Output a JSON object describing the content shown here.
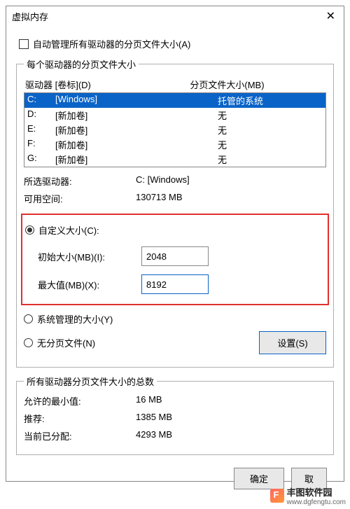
{
  "title": "虚拟内存",
  "auto_manage_label": "自动管理所有驱动器的分页文件大小(A)",
  "group1_legend": "每个驱动器的分页文件大小",
  "drive_header_left": "驱动器 [卷标](D)",
  "drive_header_right": "分页文件大小(MB)",
  "drives": [
    {
      "letter": "C:",
      "label": "[Windows]",
      "size": "托管的系统",
      "selected": true
    },
    {
      "letter": "D:",
      "label": "[新加卷]",
      "size": "无",
      "selected": false
    },
    {
      "letter": "E:",
      "label": "[新加卷]",
      "size": "无",
      "selected": false
    },
    {
      "letter": "F:",
      "label": "[新加卷]",
      "size": "无",
      "selected": false
    },
    {
      "letter": "G:",
      "label": "[新加卷]",
      "size": "无",
      "selected": false
    }
  ],
  "selected_drive_label": "所选驱动器:",
  "selected_drive_value": "C:  [Windows]",
  "available_label": "可用空间:",
  "available_value": "130713 MB",
  "radio_custom": "自定义大小(C):",
  "initial_label": "初始大小(MB)(I):",
  "initial_value": "2048",
  "max_label": "最大值(MB)(X):",
  "max_value": "8192",
  "radio_system": "系统管理的大小(Y)",
  "radio_none": "无分页文件(N)",
  "set_button": "设置(S)",
  "totals_legend": "所有驱动器分页文件大小的总数",
  "min_allowed_label": "允许的最小值:",
  "min_allowed_value": "16 MB",
  "recommended_label": "推荐:",
  "recommended_value": "1385 MB",
  "allocated_label": "当前已分配:",
  "allocated_value": "4293 MB",
  "ok_button": "确定",
  "cancel_button": "取",
  "watermark_main": "丰图软件园",
  "watermark_sub": "www.dgfengtu.com"
}
